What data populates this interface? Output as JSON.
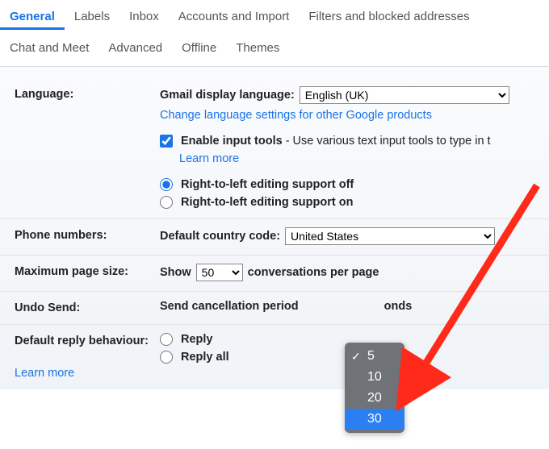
{
  "tabs": {
    "row1": [
      "General",
      "Labels",
      "Inbox",
      "Accounts and Import",
      "Filters and blocked addresses"
    ],
    "row2": [
      "Chat and Meet",
      "Advanced",
      "Offline",
      "Themes"
    ],
    "active": "General"
  },
  "language": {
    "label": "Language:",
    "display_label": "Gmail display language:",
    "selected": "English (UK)",
    "change_link": "Change language settings for other Google products",
    "enable_tools_label": "Enable input tools",
    "enable_tools_desc": " - Use various text input tools to type in t",
    "learn_more": "Learn more",
    "rtl_off": "Right-to-left editing support off",
    "rtl_on": "Right-to-left editing support on"
  },
  "phone": {
    "label": "Phone numbers:",
    "country_label": "Default country code:",
    "selected": "United States"
  },
  "page_size": {
    "label": "Maximum page size:",
    "show": "Show",
    "selected": "50",
    "suffix": "conversations per page"
  },
  "undo_send": {
    "label": "Undo Send:",
    "period_label": "Send cancellation period",
    "suffix": "onds",
    "options": [
      "5",
      "10",
      "20",
      "30"
    ],
    "current": "5",
    "highlighted": "30"
  },
  "reply": {
    "label": "Default reply behaviour:",
    "reply": "Reply",
    "reply_all": "Reply all",
    "learn_more": "Learn more"
  }
}
